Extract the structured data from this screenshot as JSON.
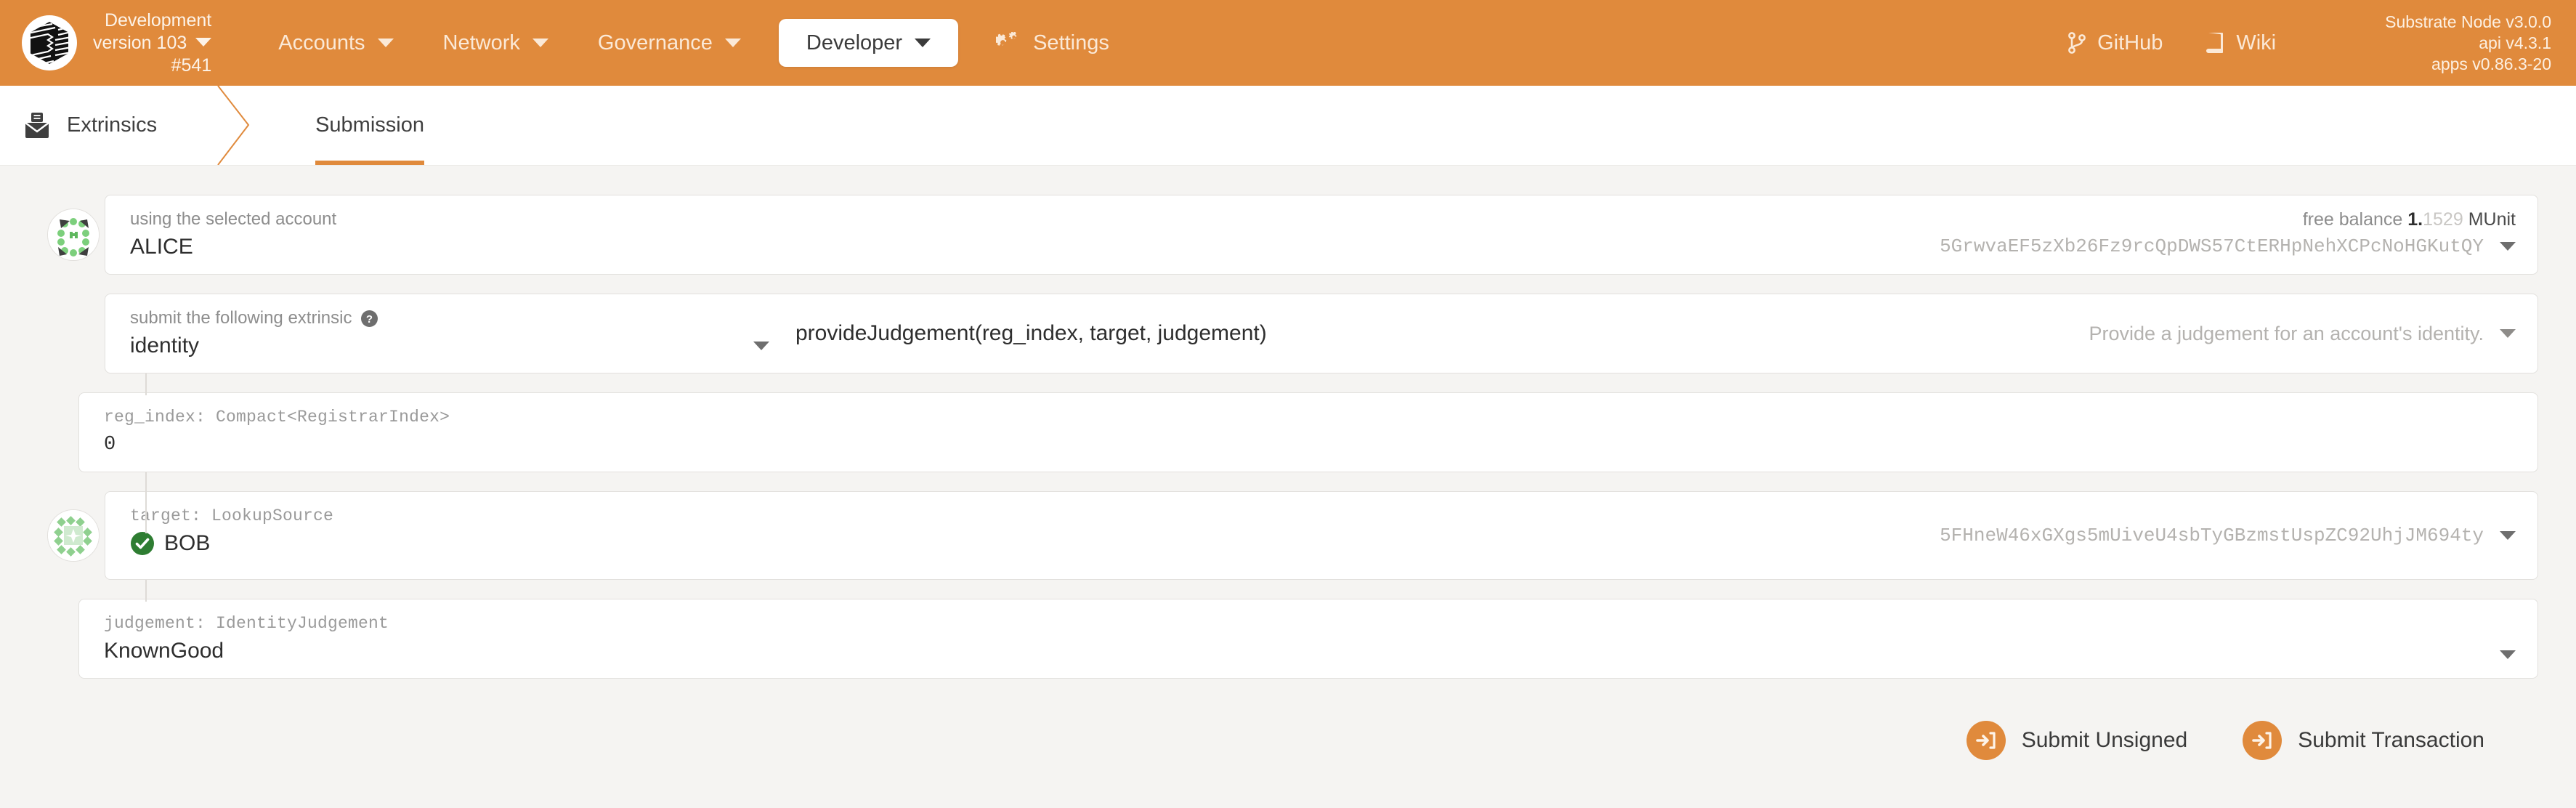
{
  "theme": {
    "accent": "#e08a3c",
    "page_bg": "#f5f4f2",
    "panel_bg": "#ffffff",
    "border": "#e2e0dd",
    "text_dark": "#2e2e2e",
    "text_muted": "#8d8d8d",
    "text_faint": "#b4b2af",
    "success": "#2e7d32"
  },
  "header": {
    "logo_icon": "substrate-hexagon-logo",
    "chain": {
      "name": "Development",
      "version": "version 103",
      "block": "#541",
      "caret_icon": "chevron-down-icon"
    },
    "nav": [
      {
        "label": "Accounts",
        "has_caret": true,
        "active": false,
        "icon": null
      },
      {
        "label": "Network",
        "has_caret": true,
        "active": false,
        "icon": null
      },
      {
        "label": "Governance",
        "has_caret": true,
        "active": false,
        "icon": null
      },
      {
        "label": "Developer",
        "has_caret": true,
        "active": true,
        "icon": null
      },
      {
        "label": "Settings",
        "has_caret": false,
        "active": false,
        "icon": "cogs-icon"
      }
    ],
    "external_links": [
      {
        "label": "GitHub",
        "icon": "git-branch-icon"
      },
      {
        "label": "Wiki",
        "icon": "book-icon"
      }
    ],
    "versions": {
      "node": "Substrate Node v3.0.0",
      "api": "api v4.3.1",
      "apps": "apps v0.86.3-20"
    }
  },
  "tabs": {
    "items": [
      {
        "label": "Extrinsics",
        "icon": "inbox-envelope-icon",
        "active": false
      },
      {
        "label": "Submission",
        "icon": null,
        "active": true
      }
    ]
  },
  "main": {
    "account": {
      "label": "using the selected account",
      "name": "ALICE",
      "identicon": "alice-identicon",
      "balance": {
        "label": "free balance",
        "major": "1.",
        "minor": "1529",
        "unit": "MUnit"
      },
      "address": "5GrwvaEF5zXb26Fz9rcQpDWS57CtERHpNehXCPcNoHGKutQY",
      "caret_icon": "chevron-down-icon"
    },
    "extrinsic": {
      "label": "submit the following extrinsic",
      "help_icon": "help-circle-icon",
      "section": "identity",
      "section_caret_icon": "chevron-down-icon",
      "method": "provideJudgement(reg_index, target, judgement)",
      "method_description": "Provide a judgement for an account's identity.",
      "method_caret_icon": "chevron-down-icon"
    },
    "params": [
      {
        "key": "reg_index",
        "label": "reg_index: Compact<RegistrarIndex>",
        "value": "0",
        "type": "text",
        "identicon": null,
        "status_icon": null,
        "address": null,
        "caret_icon": null
      },
      {
        "key": "target",
        "label": "target: LookupSource",
        "value": "BOB",
        "type": "account",
        "identicon": "bob-identicon",
        "status_icon": "check-circle-icon",
        "address": "5FHneW46xGXgs5mUiveU4sbTyGBzmstUspZC92UhjJM694ty",
        "caret_icon": "chevron-down-icon"
      },
      {
        "key": "judgement",
        "label": "judgement: IdentityJudgement",
        "value": "KnownGood",
        "type": "select",
        "identicon": null,
        "status_icon": null,
        "address": null,
        "caret_icon": "chevron-down-icon"
      }
    ],
    "actions": [
      {
        "label": "Submit Unsigned",
        "icon": "sign-in-arrow-icon"
      },
      {
        "label": "Submit Transaction",
        "icon": "sign-in-arrow-icon"
      }
    ]
  }
}
